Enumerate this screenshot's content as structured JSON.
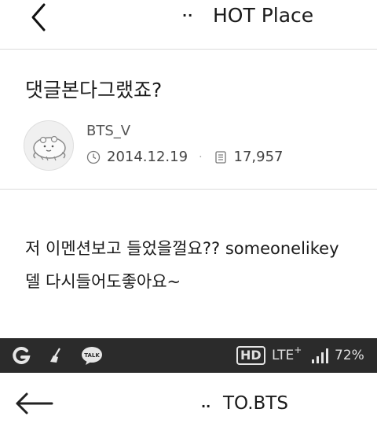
{
  "header": {
    "dots": "··",
    "title": "HOT Place"
  },
  "post": {
    "title": "댓글본다그랬죠?",
    "author": "BTS_V",
    "date": "2014.12.19",
    "separator": "·",
    "views": "17,957",
    "body_lines": [
      "저 이멘션보고 들었을껄요?? someonelikey",
      "델 다시들어도좋아요~"
    ]
  },
  "status_bar": {
    "app_icon_g": "G",
    "talk_label": "TALK",
    "hd_label": "HD",
    "network_label": "LTE",
    "network_sup": "+",
    "battery_label": "72%",
    "colors": {
      "background": "#2b2b2b",
      "icon": "#e6e6e6"
    }
  },
  "bottom_header": {
    "dots": "··",
    "title": "TO.BTS"
  },
  "icons": [
    "back-arrow-icon",
    "clock-icon",
    "document-icon",
    "signal-icon",
    "talk-icon",
    "broom-icon",
    "back-arrow-large-icon"
  ]
}
